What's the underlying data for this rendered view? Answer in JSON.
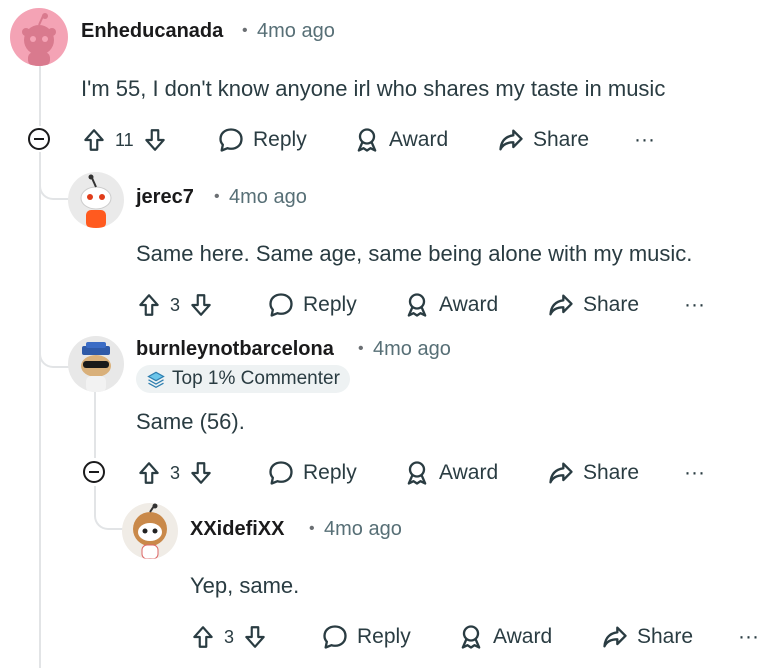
{
  "comments": [
    {
      "user": "Enheducanada",
      "sep": "•",
      "time": "4mo ago",
      "text": "I'm 55, I don't know anyone irl who shares my taste in music",
      "votes": "11",
      "reply": "Reply",
      "award": "Award",
      "share": "Share",
      "more": "···"
    },
    {
      "user": "jerec7",
      "sep": "•",
      "time": "4mo ago",
      "text": "Same here. Same age, same being alone with my music.",
      "votes": "3",
      "reply": "Reply",
      "award": "Award",
      "share": "Share",
      "more": "···"
    },
    {
      "user": "burnleynotbarcelona",
      "sep": "•",
      "time": "4mo ago",
      "badge": "Top 1% Commenter",
      "text": "Same (56).",
      "votes": "3",
      "reply": "Reply",
      "award": "Award",
      "share": "Share",
      "more": "···"
    },
    {
      "user": "XXidefiXX",
      "sep": "•",
      "time": "4mo ago",
      "text": "Yep, same.",
      "votes": "3",
      "reply": "Reply",
      "award": "Award",
      "share": "Share",
      "more": "···"
    }
  ],
  "icons": {
    "upvote": "upvote-arrow-icon",
    "downvote": "downvote-arrow-icon",
    "reply": "speech-bubble-icon",
    "award": "award-ribbon-icon",
    "share": "share-arrow-icon",
    "collapse": "collapse-minus-icon",
    "badge": "commenter-badge-icon"
  },
  "colors": {
    "thread_line": "#e2e4e6",
    "text": "#2a3c42",
    "meta": "#576f76",
    "avatar_pink": "#f4a3b5"
  }
}
